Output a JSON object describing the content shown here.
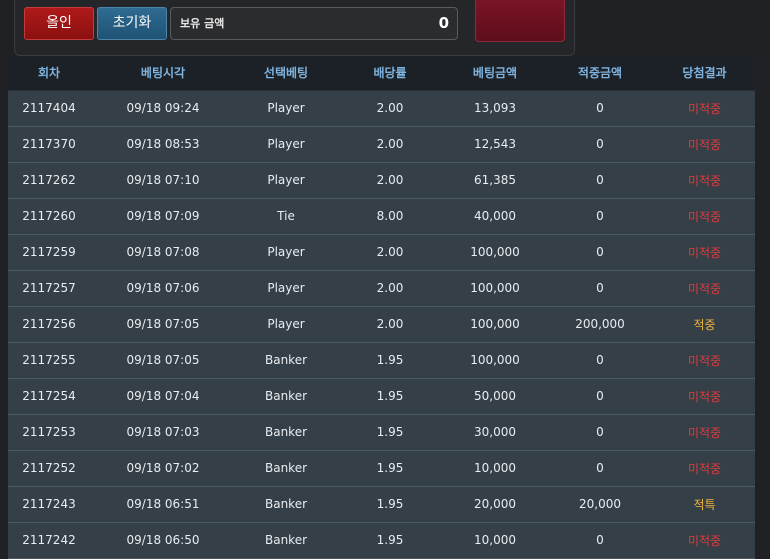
{
  "controls": {
    "allin_label": "올인",
    "reset_label": "초기화",
    "balance_label": "보유 금액",
    "balance_value": "0"
  },
  "table": {
    "headers": [
      "회차",
      "베팅시각",
      "선택베팅",
      "배당률",
      "베팅금액",
      "적중금액",
      "당첨결과"
    ],
    "rows": [
      {
        "round": "2117404",
        "time": "09/18 09:24",
        "pick": "Player",
        "odds": "2.00",
        "bet": "13,093",
        "payout": "0",
        "result": "미적중",
        "status": "lose"
      },
      {
        "round": "2117370",
        "time": "09/18 08:53",
        "pick": "Player",
        "odds": "2.00",
        "bet": "12,543",
        "payout": "0",
        "result": "미적중",
        "status": "lose"
      },
      {
        "round": "2117262",
        "time": "09/18 07:10",
        "pick": "Player",
        "odds": "2.00",
        "bet": "61,385",
        "payout": "0",
        "result": "미적중",
        "status": "lose"
      },
      {
        "round": "2117260",
        "time": "09/18 07:09",
        "pick": "Tie",
        "odds": "8.00",
        "bet": "40,000",
        "payout": "0",
        "result": "미적중",
        "status": "lose"
      },
      {
        "round": "2117259",
        "time": "09/18 07:08",
        "pick": "Player",
        "odds": "2.00",
        "bet": "100,000",
        "payout": "0",
        "result": "미적중",
        "status": "lose"
      },
      {
        "round": "2117257",
        "time": "09/18 07:06",
        "pick": "Player",
        "odds": "2.00",
        "bet": "100,000",
        "payout": "0",
        "result": "미적중",
        "status": "lose"
      },
      {
        "round": "2117256",
        "time": "09/18 07:05",
        "pick": "Player",
        "odds": "2.00",
        "bet": "100,000",
        "payout": "200,000",
        "result": "적중",
        "status": "win"
      },
      {
        "round": "2117255",
        "time": "09/18 07:05",
        "pick": "Banker",
        "odds": "1.95",
        "bet": "100,000",
        "payout": "0",
        "result": "미적중",
        "status": "lose"
      },
      {
        "round": "2117254",
        "time": "09/18 07:04",
        "pick": "Banker",
        "odds": "1.95",
        "bet": "50,000",
        "payout": "0",
        "result": "미적중",
        "status": "lose"
      },
      {
        "round": "2117253",
        "time": "09/18 07:03",
        "pick": "Banker",
        "odds": "1.95",
        "bet": "30,000",
        "payout": "0",
        "result": "미적중",
        "status": "lose"
      },
      {
        "round": "2117252",
        "time": "09/18 07:02",
        "pick": "Banker",
        "odds": "1.95",
        "bet": "10,000",
        "payout": "0",
        "result": "미적중",
        "status": "lose"
      },
      {
        "round": "2117243",
        "time": "09/18 06:51",
        "pick": "Banker",
        "odds": "1.95",
        "bet": "20,000",
        "payout": "20,000",
        "result": "적특",
        "status": "win"
      },
      {
        "round": "2117242",
        "time": "09/18 06:50",
        "pick": "Banker",
        "odds": "1.95",
        "bet": "10,000",
        "payout": "0",
        "result": "미적중",
        "status": "lose"
      }
    ]
  },
  "colors": {
    "lose": "#e23b3b",
    "win": "#f0b43c",
    "header_text": "#7fb3de"
  }
}
